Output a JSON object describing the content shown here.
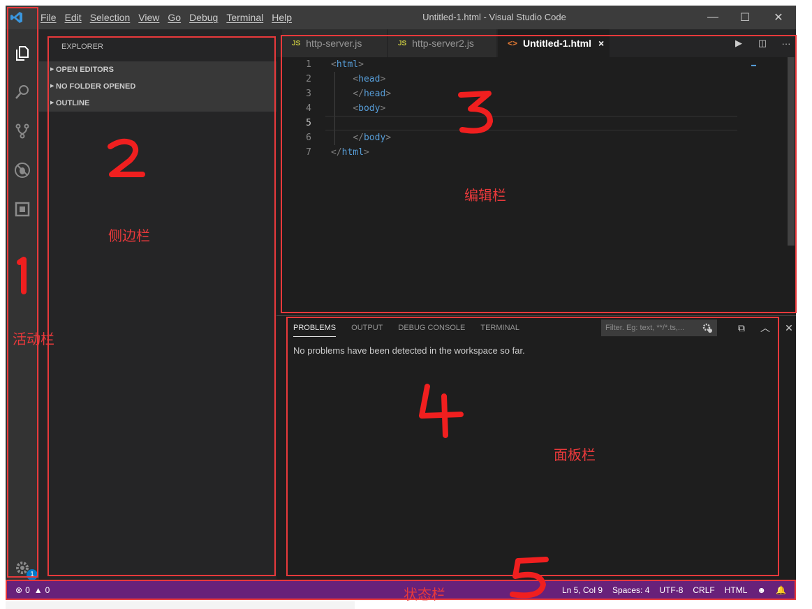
{
  "titlebar": {
    "menu": [
      "File",
      "Edit",
      "Selection",
      "View",
      "Go",
      "Debug",
      "Terminal",
      "Help"
    ],
    "title": "Untitled-1.html - Visual Studio Code",
    "minimize": "—",
    "maximize": "☐",
    "close": "✕"
  },
  "sidebar": {
    "title": "EXPLORER",
    "sections": [
      "OPEN EDITORS",
      "NO FOLDER OPENED",
      "OUTLINE"
    ]
  },
  "editor": {
    "tabs": [
      {
        "badge": "JS",
        "label": "http-server.js"
      },
      {
        "badge": "JS",
        "label": "http-server2.js"
      },
      {
        "badge": "<>",
        "label": "Untitled-1.html",
        "close": "×"
      }
    ],
    "lines": [
      {
        "num": "1",
        "indent": "",
        "tag": "html",
        "closing": false
      },
      {
        "num": "2",
        "indent": "    ",
        "tag": "head",
        "closing": false
      },
      {
        "num": "3",
        "indent": "    ",
        "tag": "head",
        "closing": true
      },
      {
        "num": "4",
        "indent": "    ",
        "tag": "body",
        "closing": false
      },
      {
        "num": "5",
        "indent": "",
        "tag": "",
        "closing": false
      },
      {
        "num": "6",
        "indent": "    ",
        "tag": "body",
        "closing": true
      },
      {
        "num": "7",
        "indent": "",
        "tag": "html",
        "closing": true
      }
    ],
    "current_line": 5
  },
  "panel": {
    "tabs": [
      "PROBLEMS",
      "OUTPUT",
      "DEBUG CONSOLE",
      "TERMINAL"
    ],
    "active_tab": "PROBLEMS",
    "filter_placeholder": "Filter. Eg: text, **/*.ts,...",
    "message": "No problems have been detected in the workspace so far."
  },
  "statusbar": {
    "errors": "0",
    "warnings": "0",
    "position": "Ln 5, Col 9",
    "spaces": "Spaces: 4",
    "encoding": "UTF-8",
    "eol": "CRLF",
    "language": "HTML"
  },
  "activitybar": {
    "settings_badge": "1"
  },
  "annotations": {
    "activity_label": "活动栏",
    "sidebar_label": "侧边栏",
    "editor_label": "编辑栏",
    "panel_label": "面板栏",
    "status_label": "状态栏"
  },
  "colors": {
    "accent": "#007acc",
    "statusbar": "#68217a",
    "annotation": "#e8393b"
  }
}
